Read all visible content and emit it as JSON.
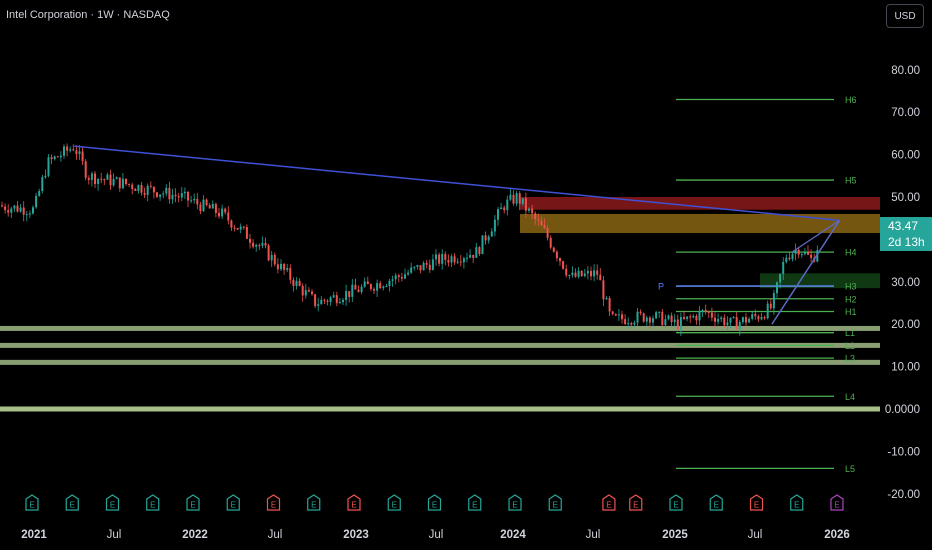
{
  "header": {
    "title": "Intel Corporation · 1W · NASDAQ",
    "currency": "USD"
  },
  "price_tag": {
    "price": "43.47",
    "countdown": "2d 13h"
  },
  "colors": {
    "up": "#26a69a",
    "down": "#ef5350",
    "trendline": "#3f51d6",
    "pivot_line": "#4caf50",
    "support_band": "#c5e1a5",
    "resistance_zone": "#8b1a1a",
    "supply_zone": "#8a6514"
  },
  "chart_data": {
    "type": "candlestick",
    "x_axis_labels": [
      "2021",
      "Jul",
      "2022",
      "Jul",
      "2023",
      "Jul",
      "2024",
      "Jul",
      "2025",
      "Jul",
      "2026"
    ],
    "y_axis_labels": [
      "80.00",
      "70.00",
      "60.00",
      "50.00",
      "40.00",
      "30.00",
      "20.00",
      "10.00",
      "0.0000",
      "-10.00",
      "-20.00"
    ],
    "ylim": [
      -20,
      85
    ],
    "price_path": [
      [
        "2020-10",
        48
      ],
      [
        "2021-01",
        47
      ],
      [
        "2021-02",
        58
      ],
      [
        "2021-04",
        62
      ],
      [
        "2021-05",
        55
      ],
      [
        "2021-08",
        53
      ],
      [
        "2021-12",
        50
      ],
      [
        "2022-03",
        46
      ],
      [
        "2022-06",
        38
      ],
      [
        "2022-09",
        28
      ],
      [
        "2022-10",
        25
      ],
      [
        "2023-01",
        28
      ],
      [
        "2023-04",
        31
      ],
      [
        "2023-07",
        35
      ],
      [
        "2023-10",
        37
      ],
      [
        "2023-12",
        48
      ],
      [
        "2024-01",
        50
      ],
      [
        "2024-03",
        42
      ],
      [
        "2024-05",
        31
      ],
      [
        "2024-07",
        32
      ],
      [
        "2024-08",
        21
      ],
      [
        "2024-11",
        22
      ],
      [
        "2025-01",
        20
      ],
      [
        "2025-03",
        23
      ],
      [
        "2025-05",
        20
      ],
      [
        "2025-07",
        22
      ],
      [
        "2025-08",
        24
      ],
      [
        "2025-09",
        36
      ],
      [
        "2025-10",
        38
      ],
      [
        "2025-11",
        35
      ],
      [
        "2025-12",
        43.47
      ]
    ],
    "pivot_levels": [
      {
        "label": "H6",
        "value": 73
      },
      {
        "label": "H5",
        "value": 54
      },
      {
        "label": "H4",
        "value": 37
      },
      {
        "label": "H3",
        "value": 29
      },
      {
        "label": "H2",
        "value": 26
      },
      {
        "label": "H1",
        "value": 23
      },
      {
        "label": "P",
        "value": 29
      },
      {
        "label": "L1",
        "value": 18
      },
      {
        "label": "L2",
        "value": 15
      },
      {
        "label": "L3",
        "value": 12
      },
      {
        "label": "L4",
        "value": 3
      },
      {
        "label": "L5",
        "value": -14
      }
    ],
    "support_bands": [
      19,
      15,
      11,
      0
    ],
    "zones": [
      {
        "name": "resistance",
        "from": 47,
        "to": 50
      },
      {
        "name": "supply",
        "from": 41.5,
        "to": 46
      }
    ],
    "trendlines": [
      {
        "from": [
          "2021-04",
          62
        ],
        "to": [
          "2025-12",
          44.5
        ]
      },
      {
        "from": [
          "2025-08",
          20
        ],
        "to": [
          "2025-12",
          44.5
        ]
      }
    ],
    "earnings_markers": [
      {
        "x": "2021-01",
        "type": "E",
        "color": "green"
      },
      {
        "x": "2021-04",
        "type": "E",
        "color": "green"
      },
      {
        "x": "2021-07",
        "type": "E",
        "color": "green"
      },
      {
        "x": "2021-10",
        "type": "E",
        "color": "green"
      },
      {
        "x": "2022-01",
        "type": "E",
        "color": "green"
      },
      {
        "x": "2022-04",
        "type": "E",
        "color": "green"
      },
      {
        "x": "2022-07",
        "type": "E",
        "color": "red"
      },
      {
        "x": "2022-10",
        "type": "E",
        "color": "green"
      },
      {
        "x": "2023-01",
        "type": "E",
        "color": "red"
      },
      {
        "x": "2023-04",
        "type": "E",
        "color": "green"
      },
      {
        "x": "2023-07",
        "type": "E",
        "color": "green"
      },
      {
        "x": "2023-10",
        "type": "E",
        "color": "green"
      },
      {
        "x": "2024-01",
        "type": "E",
        "color": "green"
      },
      {
        "x": "2024-04",
        "type": "E",
        "color": "green"
      },
      {
        "x": "2024-08",
        "type": "E",
        "color": "red"
      },
      {
        "x": "2024-10",
        "type": "E",
        "color": "red"
      },
      {
        "x": "2025-01",
        "type": "E",
        "color": "green"
      },
      {
        "x": "2025-04",
        "type": "E",
        "color": "green"
      },
      {
        "x": "2025-07",
        "type": "E",
        "color": "red"
      },
      {
        "x": "2025-10",
        "type": "E",
        "color": "green"
      },
      {
        "x": "2026-01",
        "type": "E",
        "color": "purple"
      }
    ]
  }
}
